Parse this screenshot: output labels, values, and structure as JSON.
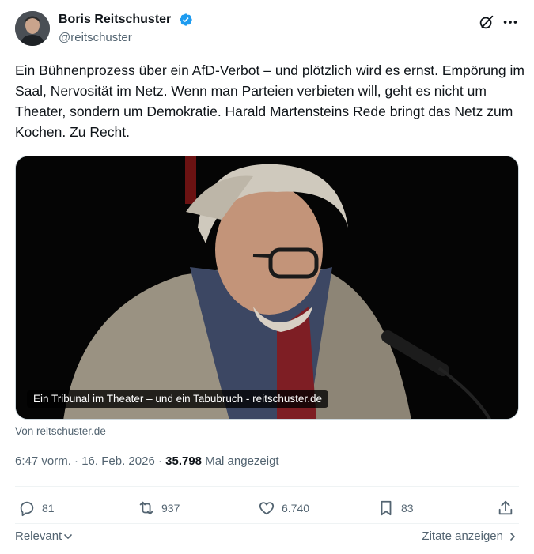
{
  "author": {
    "name": "Boris Reitschuster",
    "handle": "@reitschuster",
    "verified": true
  },
  "tweet": {
    "text": "Ein Bühnenprozess über ein AfD-Verbot – und plötzlich wird es ernst. Empörung im Saal, Nervosität im Netz. Wenn man Parteien verbieten will, geht es nicht um Theater, sondern um Demokratie. Harald Martensteins Rede bringt das Netz zum Kochen. Zu Recht."
  },
  "media": {
    "caption": "Ein Tribunal im Theater – und ein Tabubruch - reitschuster.de",
    "source": "Von reitschuster.de"
  },
  "meta": {
    "time": "6:47 vorm.",
    "separator": "·",
    "date": "16. Feb. 2026",
    "views_count": "35.798",
    "views_label": "Mal angezeigt"
  },
  "actions": {
    "replies": "81",
    "reposts": "937",
    "likes": "6.740",
    "bookmarks": "83"
  },
  "footer": {
    "sort_label": "Relevant",
    "quotes_label": "Zitate anzeigen"
  },
  "icons": {
    "verified": "verified-badge-icon",
    "grok": "grok-icon",
    "more": "more-icon",
    "reply": "reply-icon",
    "repost": "repost-icon",
    "like": "like-icon",
    "bookmark": "bookmark-icon",
    "share": "share-icon"
  },
  "colors": {
    "text_primary": "#0f1419",
    "text_secondary": "#536471",
    "verified_blue": "#1d9bf0",
    "divider": "#eff3f4"
  }
}
